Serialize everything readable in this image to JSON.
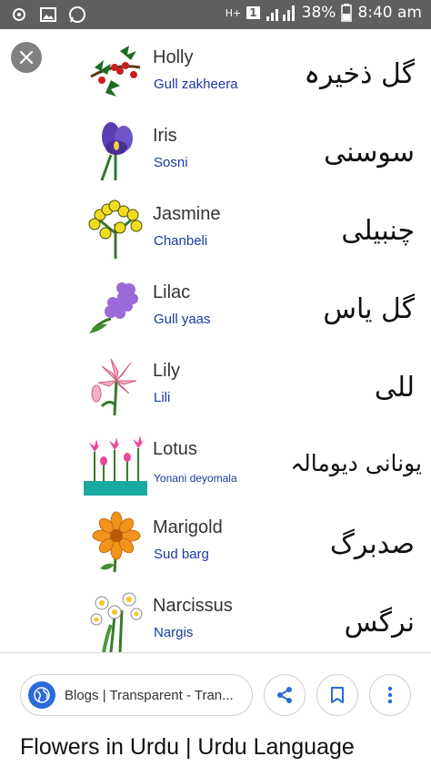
{
  "status_bar": {
    "network_label": "H+",
    "sim_label": "1",
    "battery": "38%",
    "time": "8:40 am"
  },
  "flowers": [
    {
      "english": "Holly",
      "roman": "Gull zakheera",
      "urdu": "گل ذخیرہ",
      "picture": "holly-picture"
    },
    {
      "english": "Iris",
      "roman": "Sosni",
      "urdu": "سوسنی",
      "picture": "iris-picture"
    },
    {
      "english": "Jasmine",
      "roman": "Chanbeli",
      "urdu": "چنبیلی",
      "picture": "jasmine-picture"
    },
    {
      "english": "Lilac",
      "roman": "Gull yaas",
      "urdu": "گل یاس",
      "picture": "lilac-picture"
    },
    {
      "english": "Lily",
      "roman": "Lili",
      "urdu": "للی",
      "picture": "lily-picture"
    },
    {
      "english": "Lotus",
      "roman": "Yonani deyomala",
      "urdu": "یونانی دیومالہ",
      "picture": "lotus-picture"
    },
    {
      "english": "Marigold",
      "roman": "Sud barg",
      "urdu": "صدبرگ",
      "picture": "marigold-picture"
    },
    {
      "english": "Narcissus",
      "roman": "Nargis",
      "urdu": "نرگس",
      "picture": "narcissus-picture"
    }
  ],
  "source": {
    "label": "Blogs | Transparent - Tran...",
    "icon": "globe-icon"
  },
  "actions": {
    "share_icon": "share-icon",
    "save_icon": "bookmark-icon",
    "more_icon": "more-vert-icon"
  },
  "page_title": "Flowers in Urdu | Urdu Language",
  "colors": {
    "status_bar": "#5f5f5f",
    "accent_blue": "#2a6bd8",
    "roman_text": "#1a3aa0"
  }
}
